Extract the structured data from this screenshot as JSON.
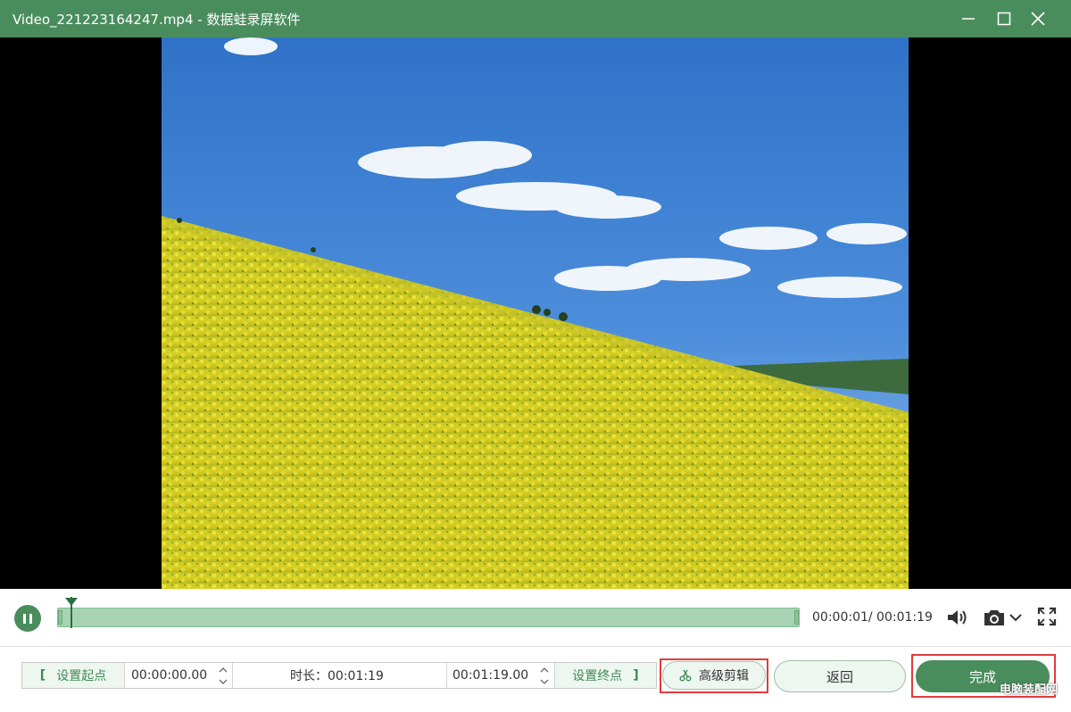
{
  "window": {
    "title": "Video_221223164247.mp4  -  数据蛙录屏软件",
    "accent_color": "#4a8d5d",
    "controls": [
      "minimize-icon",
      "maximize-icon",
      "close-icon"
    ]
  },
  "video": {
    "description_icon": "video-frame"
  },
  "player": {
    "state": "playing",
    "progress_fraction": 0.0088,
    "time_display": "00:00:01/ 00:01:19"
  },
  "trim": {
    "set_start_label": "设置起点",
    "start_time": "00:00:00.00",
    "duration_text": "时长：00:01:19",
    "end_time": "00:01:19.00",
    "set_end_label": "设置终点",
    "open_bracket": "[",
    "close_bracket": "]"
  },
  "actions": {
    "advanced_edit_label": "高级剪辑",
    "back_label": "返回",
    "done_label": "完成"
  },
  "watermark": "电脑装配网"
}
